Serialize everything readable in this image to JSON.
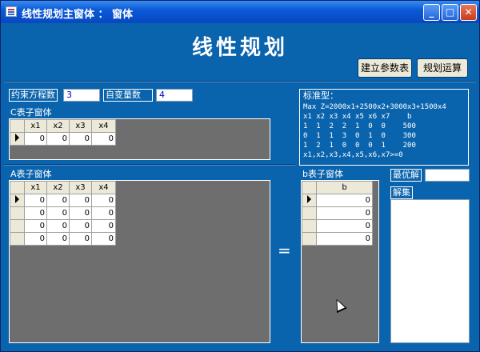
{
  "window": {
    "title": "线性规划主窗体 ： 窗体"
  },
  "heading": "线性规划",
  "buttons": {
    "build": "建立参数表",
    "solve": "规划运算"
  },
  "fields": {
    "constraints_label": "约束方程数",
    "constraints_value": "3",
    "variables_label": "自变量数",
    "variables_value": "4"
  },
  "c_form": {
    "title": "C表子窗体",
    "columns": [
      "x1",
      "x2",
      "x3",
      "x4"
    ],
    "rows": [
      [
        "0",
        "0",
        "0",
        "0"
      ]
    ]
  },
  "a_form": {
    "title": "A表子窗体",
    "columns": [
      "x1",
      "x2",
      "x3",
      "x4"
    ],
    "rows": [
      [
        "0",
        "0",
        "0",
        "0"
      ],
      [
        "0",
        "0",
        "0",
        "0"
      ],
      [
        "0",
        "0",
        "0",
        "0"
      ],
      [
        "0",
        "0",
        "0",
        "0"
      ]
    ]
  },
  "b_form": {
    "title": "b表子窗体",
    "columns": [
      "b"
    ],
    "rows": [
      "0",
      "0",
      "0",
      "0"
    ]
  },
  "equals": "=",
  "standard": {
    "title": "标准型：",
    "lines": [
      "Max Z=2000x1+2500x2+3000x3+1500x4",
      "x1 x2 x3 x4 x5 x6 x7    b",
      "1  1  2  2  1  0  0    500",
      "0  1  1  3  0  1  0    300",
      "1  2  1  0  0  0  1    200",
      "x1,x2,x3,x4,x5,x6,x7>=0"
    ]
  },
  "optimum": {
    "label": "最优解",
    "value": ""
  },
  "solution": {
    "label": "解集"
  },
  "icons": [
    "app-icon",
    "minimize-icon",
    "maximize-icon",
    "close-icon",
    "record-pointer-icon",
    "mouse-cursor-icon"
  ]
}
